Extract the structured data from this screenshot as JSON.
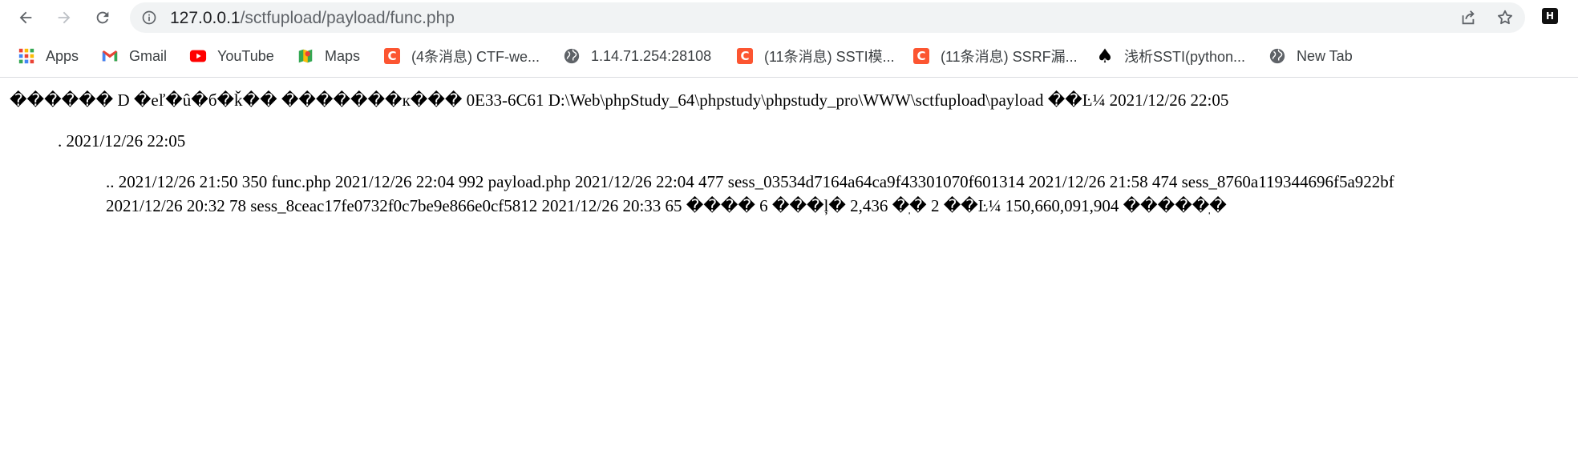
{
  "browser": {
    "url_host": "127.0.0.1",
    "url_path": "/sctfupload/payload/func.php",
    "colors": {
      "toolbar_bg": "#ffffff",
      "omnibox_bg": "#f1f3f4",
      "csdn_red": "#fc5531"
    }
  },
  "bookmarks": [
    {
      "label": "Apps",
      "icon": "apps-grid-icon"
    },
    {
      "label": "Gmail",
      "icon": "gmail-icon"
    },
    {
      "label": "YouTube",
      "icon": "youtube-icon"
    },
    {
      "label": "Maps",
      "icon": "maps-icon"
    },
    {
      "label": "(4条消息) CTF-we...",
      "icon": "csdn-icon"
    },
    {
      "label": "1.14.71.254:28108",
      "icon": "globe-icon"
    },
    {
      "label": "(11条消息) SSTI模...",
      "icon": "csdn-icon"
    },
    {
      "label": "(11条消息) SSRF漏...",
      "icon": "csdn-icon"
    },
    {
      "label": "浅析SSTI(python...",
      "icon": "spade-icon"
    },
    {
      "label": "New Tab",
      "icon": "globe-icon"
    }
  ],
  "page": {
    "line1": "������ D �еľ�û�б�ǩ�� �������к��� 0E33-6C61 D:\\Web\\phpStudy_64\\phpstudy\\phpstudy_pro\\WWW\\sctfupload\\payload ��Ŀ¼ 2021/12/26 22:05",
    "line2": ". 2021/12/26 22:05",
    "line3": ".. 2021/12/26 21:50 350 func.php 2021/12/26 22:04 992 payload.php 2021/12/26 22:04 477 sess_03534d7164a64ca9f43301070f601314 2021/12/26 21:58 474 sess_8760a119344696f5a922bf",
    "line4": "2021/12/26 20:32 78 sess_8ceac17fe0732f0c7be9e866e0cf5812 2021/12/26 20:33 65 ���� 6 ���ļ� 2,436 �ֽ� 2 ��Ŀ¼ 150,660,091,904 �����ֽ�"
  }
}
